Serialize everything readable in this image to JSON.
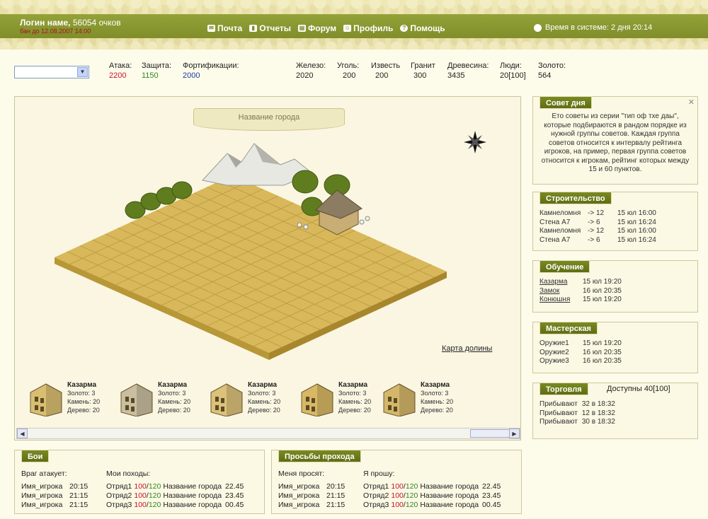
{
  "header": {
    "user_name": "Логин наме,",
    "points": "56054 очков",
    "ban": "бан до 12.08.2007 14:00",
    "nav": [
      {
        "label": "Почта",
        "icon": "mail-icon"
      },
      {
        "label": "Отчеты",
        "icon": "reports-icon"
      },
      {
        "label": "Форум",
        "icon": "forum-icon"
      },
      {
        "label": "Профиль",
        "icon": "profile-icon"
      },
      {
        "label": "Помощь",
        "icon": "help-icon"
      }
    ],
    "time": "Время в системе: 2 дня 20:14"
  },
  "stats": [
    {
      "label": "Атака:",
      "value": "2200",
      "color": "#c8142a"
    },
    {
      "label": "Защита:",
      "value": "1150",
      "color": "#2b8a22"
    },
    {
      "label": "Фортификации:",
      "value": "2000",
      "color": "#1c3e9c"
    },
    {
      "label": "Железо:",
      "value": "2020",
      "color": "#222"
    },
    {
      "label": "Уголь:",
      "value": "200",
      "color": "#222"
    },
    {
      "label": "Известь",
      "value": "200",
      "color": "#222"
    },
    {
      "label": "Гранит",
      "value": "300",
      "color": "#222"
    },
    {
      "label": "Древесина:",
      "value": "3435",
      "color": "#222"
    },
    {
      "label": "Люди:",
      "value": "20[100]",
      "color": "#222"
    },
    {
      "label": "Золото:",
      "value": "564",
      "color": "#222"
    }
  ],
  "city": {
    "name": "Название города",
    "valley_link": "Карта долины"
  },
  "buildings": [
    {
      "name": "Казарма",
      "gold": "Золото: 3",
      "stone": "Камень: 20",
      "wood": "Дерево: 20",
      "color": "#d9be72"
    },
    {
      "name": "Казарма",
      "gold": "Золото: 3",
      "stone": "Камень: 20",
      "wood": "Дерево: 20",
      "color": "#c9bea0"
    },
    {
      "name": "Казарма",
      "gold": "Золото: 3",
      "stone": "Камень: 20",
      "wood": "Дерево: 20",
      "color": "#dcc17a"
    },
    {
      "name": "Казарма",
      "gold": "Золото: 3",
      "stone": "Камень: 20",
      "wood": "Дерево: 20",
      "color": "#d8b865"
    },
    {
      "name": "Казарма",
      "gold": "Золото: 3",
      "stone": "Камень: 20",
      "wood": "Дерево: 20",
      "color": "#d4b76a"
    }
  ],
  "tip": {
    "title": "Совет дня",
    "text": "Ето советы из серии \"тип оф тхе даы\", которые подбираются в рандом порядке из нужной группы советов. Каждая группа советов относится к интервалу рейтинга игроков, на пример, первая группа советов относится к игрокам, рейтинг которых между 15 и 60 пунктов."
  },
  "construction": {
    "title": "Строительство",
    "rows": [
      {
        "name": "Камнеломня",
        "arrow": "-> 12",
        "time": "15 юл 16:00"
      },
      {
        "name": "Стена А7",
        "arrow": "-> 6",
        "time": "15 юл 16:24"
      },
      {
        "name": "Камнеломня",
        "arrow": "-> 12",
        "time": "15 юл 16:00"
      },
      {
        "name": "Стена А7",
        "arrow": "-> 6",
        "time": "15 юл 16:24"
      }
    ]
  },
  "training": {
    "title": "Обучение",
    "rows": [
      {
        "name": "Казарма",
        "time": "15 юл 19:20"
      },
      {
        "name": "Замок",
        "time": "16 юл 20:35"
      },
      {
        "name": "Конюшня",
        "time": "15 юл 19:20"
      }
    ]
  },
  "workshop": {
    "title": "Мастерская",
    "rows": [
      {
        "name": "Оружие1",
        "time": "15 юл 19:20"
      },
      {
        "name": "Оружие2",
        "time": "16 юл 20:35"
      },
      {
        "name": "Оружие3",
        "time": "16 юл 20:35"
      }
    ]
  },
  "trade": {
    "title": "Торговля",
    "available": "Доступны 40[100]",
    "rows": [
      {
        "text": "Прибывают",
        "val": "32 в 18:32"
      },
      {
        "text": "Прибывают",
        "val": "12 в 18:32"
      },
      {
        "text": "Прибывают",
        "val": "30 в 18:32"
      }
    ]
  },
  "battles": {
    "title": "Бои",
    "left_head": "Враг атакует:",
    "right_head": "Мои походы:",
    "left": [
      {
        "name": "Имя_игрока",
        "time": "20:15"
      },
      {
        "name": "Имя_игрока",
        "time": "21:15"
      },
      {
        "name": "Имя_игрока",
        "time": "21:15"
      }
    ],
    "right": [
      {
        "unit": "Отряд1",
        "a": "100",
        "b": "120",
        "city": "Название города",
        "time": "22.45"
      },
      {
        "unit": "Отряд2",
        "a": "100",
        "b": "120",
        "city": "Название города",
        "time": "23.45"
      },
      {
        "unit": "Отряд3",
        "a": "100",
        "b": "120",
        "city": "Название города",
        "time": "00.45"
      }
    ]
  },
  "passage": {
    "title": "Просьбы прохода",
    "left_head": "Меня просят:",
    "right_head": "Я прошу:",
    "left": [
      {
        "name": "Имя_игрока",
        "time": "20:15"
      },
      {
        "name": "Имя_игрока",
        "time": "21:15"
      },
      {
        "name": "Имя_игрока",
        "time": "21:15"
      }
    ],
    "right": [
      {
        "unit": "Отряд1",
        "a": "100",
        "b": "120",
        "city": "Название города",
        "time": "22.45"
      },
      {
        "unit": "Отряд2",
        "a": "100",
        "b": "120",
        "city": "Название города",
        "time": "23.45"
      },
      {
        "unit": "Отряд3",
        "a": "100",
        "b": "120",
        "city": "Название города",
        "time": "00.45"
      }
    ]
  },
  "colors": {
    "accent": "#7a8a23",
    "field": "#d8b85a",
    "gold_red": "#c8142a",
    "gold_green": "#2b8a22"
  }
}
